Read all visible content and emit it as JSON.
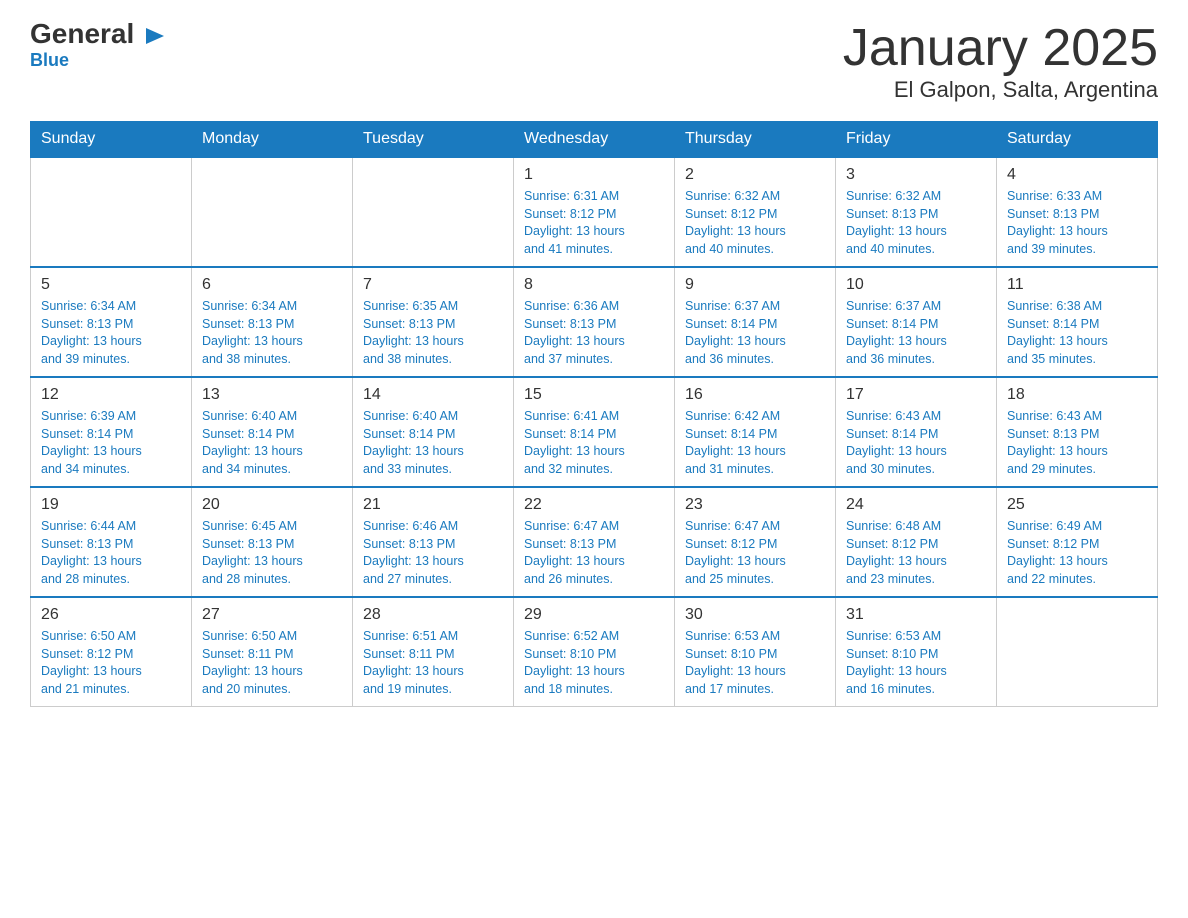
{
  "logo": {
    "general": "General",
    "arrow": "▶",
    "blue": "Blue"
  },
  "title": "January 2025",
  "subtitle": "El Galpon, Salta, Argentina",
  "weekdays": [
    "Sunday",
    "Monday",
    "Tuesday",
    "Wednesday",
    "Thursday",
    "Friday",
    "Saturday"
  ],
  "weeks": [
    [
      {
        "day": "",
        "info": ""
      },
      {
        "day": "",
        "info": ""
      },
      {
        "day": "",
        "info": ""
      },
      {
        "day": "1",
        "info": "Sunrise: 6:31 AM\nSunset: 8:12 PM\nDaylight: 13 hours\nand 41 minutes."
      },
      {
        "day": "2",
        "info": "Sunrise: 6:32 AM\nSunset: 8:12 PM\nDaylight: 13 hours\nand 40 minutes."
      },
      {
        "day": "3",
        "info": "Sunrise: 6:32 AM\nSunset: 8:13 PM\nDaylight: 13 hours\nand 40 minutes."
      },
      {
        "day": "4",
        "info": "Sunrise: 6:33 AM\nSunset: 8:13 PM\nDaylight: 13 hours\nand 39 minutes."
      }
    ],
    [
      {
        "day": "5",
        "info": "Sunrise: 6:34 AM\nSunset: 8:13 PM\nDaylight: 13 hours\nand 39 minutes."
      },
      {
        "day": "6",
        "info": "Sunrise: 6:34 AM\nSunset: 8:13 PM\nDaylight: 13 hours\nand 38 minutes."
      },
      {
        "day": "7",
        "info": "Sunrise: 6:35 AM\nSunset: 8:13 PM\nDaylight: 13 hours\nand 38 minutes."
      },
      {
        "day": "8",
        "info": "Sunrise: 6:36 AM\nSunset: 8:13 PM\nDaylight: 13 hours\nand 37 minutes."
      },
      {
        "day": "9",
        "info": "Sunrise: 6:37 AM\nSunset: 8:14 PM\nDaylight: 13 hours\nand 36 minutes."
      },
      {
        "day": "10",
        "info": "Sunrise: 6:37 AM\nSunset: 8:14 PM\nDaylight: 13 hours\nand 36 minutes."
      },
      {
        "day": "11",
        "info": "Sunrise: 6:38 AM\nSunset: 8:14 PM\nDaylight: 13 hours\nand 35 minutes."
      }
    ],
    [
      {
        "day": "12",
        "info": "Sunrise: 6:39 AM\nSunset: 8:14 PM\nDaylight: 13 hours\nand 34 minutes."
      },
      {
        "day": "13",
        "info": "Sunrise: 6:40 AM\nSunset: 8:14 PM\nDaylight: 13 hours\nand 34 minutes."
      },
      {
        "day": "14",
        "info": "Sunrise: 6:40 AM\nSunset: 8:14 PM\nDaylight: 13 hours\nand 33 minutes."
      },
      {
        "day": "15",
        "info": "Sunrise: 6:41 AM\nSunset: 8:14 PM\nDaylight: 13 hours\nand 32 minutes."
      },
      {
        "day": "16",
        "info": "Sunrise: 6:42 AM\nSunset: 8:14 PM\nDaylight: 13 hours\nand 31 minutes."
      },
      {
        "day": "17",
        "info": "Sunrise: 6:43 AM\nSunset: 8:14 PM\nDaylight: 13 hours\nand 30 minutes."
      },
      {
        "day": "18",
        "info": "Sunrise: 6:43 AM\nSunset: 8:13 PM\nDaylight: 13 hours\nand 29 minutes."
      }
    ],
    [
      {
        "day": "19",
        "info": "Sunrise: 6:44 AM\nSunset: 8:13 PM\nDaylight: 13 hours\nand 28 minutes."
      },
      {
        "day": "20",
        "info": "Sunrise: 6:45 AM\nSunset: 8:13 PM\nDaylight: 13 hours\nand 28 minutes."
      },
      {
        "day": "21",
        "info": "Sunrise: 6:46 AM\nSunset: 8:13 PM\nDaylight: 13 hours\nand 27 minutes."
      },
      {
        "day": "22",
        "info": "Sunrise: 6:47 AM\nSunset: 8:13 PM\nDaylight: 13 hours\nand 26 minutes."
      },
      {
        "day": "23",
        "info": "Sunrise: 6:47 AM\nSunset: 8:12 PM\nDaylight: 13 hours\nand 25 minutes."
      },
      {
        "day": "24",
        "info": "Sunrise: 6:48 AM\nSunset: 8:12 PM\nDaylight: 13 hours\nand 23 minutes."
      },
      {
        "day": "25",
        "info": "Sunrise: 6:49 AM\nSunset: 8:12 PM\nDaylight: 13 hours\nand 22 minutes."
      }
    ],
    [
      {
        "day": "26",
        "info": "Sunrise: 6:50 AM\nSunset: 8:12 PM\nDaylight: 13 hours\nand 21 minutes."
      },
      {
        "day": "27",
        "info": "Sunrise: 6:50 AM\nSunset: 8:11 PM\nDaylight: 13 hours\nand 20 minutes."
      },
      {
        "day": "28",
        "info": "Sunrise: 6:51 AM\nSunset: 8:11 PM\nDaylight: 13 hours\nand 19 minutes."
      },
      {
        "day": "29",
        "info": "Sunrise: 6:52 AM\nSunset: 8:10 PM\nDaylight: 13 hours\nand 18 minutes."
      },
      {
        "day": "30",
        "info": "Sunrise: 6:53 AM\nSunset: 8:10 PM\nDaylight: 13 hours\nand 17 minutes."
      },
      {
        "day": "31",
        "info": "Sunrise: 6:53 AM\nSunset: 8:10 PM\nDaylight: 13 hours\nand 16 minutes."
      },
      {
        "day": "",
        "info": ""
      }
    ]
  ]
}
